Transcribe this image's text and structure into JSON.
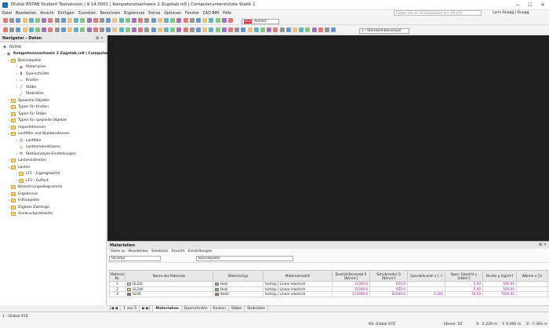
{
  "window": {
    "title": "Dlubal RSTAB Student Testversion | 9.14.0001 | Kompetenznachweis 2 Zugstab.rs9 | Computerunterstützte Statik 1",
    "controls": [
      "—",
      "☐",
      "✕"
    ]
  },
  "menu": {
    "items": [
      "Datei",
      "Bearbeiten",
      "Ansicht",
      "Einfügen",
      "Zuordnen",
      "Berechnen",
      "Ergebnisse",
      "Extras",
      "Optionen",
      "Fenster",
      "CAD-BIM",
      "Hilfe"
    ],
    "search_placeholder": "Geben Sie ein Schlüsselwort ein (Alt+Q)",
    "user": "Lorin Ruegg | Ruegg"
  },
  "toolbar": {
    "loadcase_tag": "LF2",
    "loadcase_name": "Auflast",
    "layer": "1 - Standard-Basislayer"
  },
  "navigator": {
    "title": "Navigator - Daten",
    "root": "RSTAB",
    "project": "Kompetenznachweis 2 Zugstab.rs9 | Computerunt",
    "items": [
      {
        "label": "Basisobjekte",
        "level": 1,
        "twisty": "⌄",
        "icon": "folder"
      },
      {
        "label": "Materialien",
        "level": 2,
        "twisty": "›",
        "icon": "material"
      },
      {
        "label": "Querschnitte",
        "level": 2,
        "twisty": "›",
        "icon": "section"
      },
      {
        "label": "Knoten",
        "level": 2,
        "twisty": "›",
        "icon": "node"
      },
      {
        "label": "Stäbe",
        "level": 2,
        "twisty": "›",
        "icon": "member"
      },
      {
        "label": "Stabsätze",
        "level": 2,
        "twisty": "",
        "icon": "memberset"
      },
      {
        "label": "Spezielle Objekte",
        "level": 1,
        "twisty": "›",
        "icon": "folder"
      },
      {
        "label": "Typen für Knoten",
        "level": 1,
        "twisty": "›",
        "icon": "folder"
      },
      {
        "label": "Typen für Stäbe",
        "level": 1,
        "twisty": "›",
        "icon": "folder"
      },
      {
        "label": "Typen für spezielle Objekte",
        "level": 1,
        "twisty": "›",
        "icon": "folder"
      },
      {
        "label": "Imperfektionen",
        "level": 1,
        "twisty": "›",
        "icon": "folder"
      },
      {
        "label": "Lastfälle und Kombinationen",
        "level": 1,
        "twisty": "⌄",
        "icon": "folder"
      },
      {
        "label": "Lastfälle",
        "level": 2,
        "twisty": "›",
        "icon": "loadcase"
      },
      {
        "label": "Lastkombinationen",
        "level": 2,
        "twisty": "",
        "icon": "loadcombo"
      },
      {
        "label": "Statikanalyse-Einstellungen",
        "level": 2,
        "twisty": "›",
        "icon": "analysis"
      },
      {
        "label": "Lastassistenten",
        "level": 1,
        "twisty": "›",
        "icon": "folder"
      },
      {
        "label": "Lasten",
        "level": 1,
        "twisty": "⌄",
        "icon": "folder"
      },
      {
        "label": "LF1 - Eigengewicht",
        "level": 2,
        "twisty": "›",
        "icon": "folder"
      },
      {
        "label": "LF2 - Auflast",
        "level": 2,
        "twisty": "›",
        "icon": "folder"
      },
      {
        "label": "Berechnungsdiagramme",
        "level": 1,
        "twisty": "",
        "icon": "folder"
      },
      {
        "label": "Ergebnisse",
        "level": 1,
        "twisty": "›",
        "icon": "folder"
      },
      {
        "label": "Hilfsobjekte",
        "level": 1,
        "twisty": "›",
        "icon": "folder"
      },
      {
        "label": "Digitale Zwillinge",
        "level": 1,
        "twisty": "›",
        "icon": "folder"
      },
      {
        "label": "Ausdruckprotokolle",
        "level": 1,
        "twisty": "",
        "icon": "folder"
      }
    ]
  },
  "materials_panel": {
    "title": "Materialien",
    "menu": [
      "Gehe zu",
      "Bearbeiten",
      "Selektion",
      "Ansicht",
      "Einstellungen"
    ],
    "filter": "Struktur",
    "object_group": "Basisobjekte",
    "headers": [
      "Material Nr.",
      "Name des Materials",
      "Material-typ",
      "Materialmodell",
      "Elastizitätsmodul E [N/mm²]",
      "Schubmodul G [N/mm²]",
      "Querdehnzahl ν [--]",
      "Spez. Gewicht γ [kN/m³]",
      "Dichte ρ [kg/m³]",
      "Wärme α [1/"
    ],
    "rows": [
      {
        "no": "1",
        "name": "GL24c",
        "type": "Holz",
        "model": "Isotrop | Linear elastisch",
        "E": "11000.0",
        "G": "650.0",
        "nu": "",
        "gamma": "5.00",
        "rho": "500.00",
        "alpha": ""
      },
      {
        "no": "2",
        "name": "GL24h",
        "type": "Holz",
        "model": "Isotrop | Linear elastisch",
        "E": "11500.0",
        "G": "650.0",
        "nu": "",
        "gamma": "5.00",
        "rho": "500.00",
        "alpha": ""
      },
      {
        "no": "3",
        "name": "S235",
        "type": "Stahl",
        "model": "Isotrop | Linear elastisch",
        "E": "210000.0",
        "G": "81000.0",
        "nu": "0.300",
        "gamma": "78.50",
        "rho": "7850.00",
        "alpha": ""
      }
    ],
    "swatch_colors": {
      "GL24c": "#f2c7a0",
      "GL24h": "#f2d94e",
      "S235": "#c65a4a"
    },
    "type_colors": {
      "Holz": "#7fb04a",
      "Stahl": "#d86a2e"
    },
    "pager": "1 von 5",
    "tabs": [
      "Materialien",
      "Querschnitte",
      "Knoten",
      "Stäbe",
      "Stabsätze"
    ]
  },
  "status": {
    "view": "1 - Global XYZ",
    "cs": "KS: Global XYZ",
    "plane": "Ebene: XZ",
    "x": "X: -2.229 m",
    "y": "Y: 0.000 m",
    "z": "Z: -7.363 m"
  }
}
